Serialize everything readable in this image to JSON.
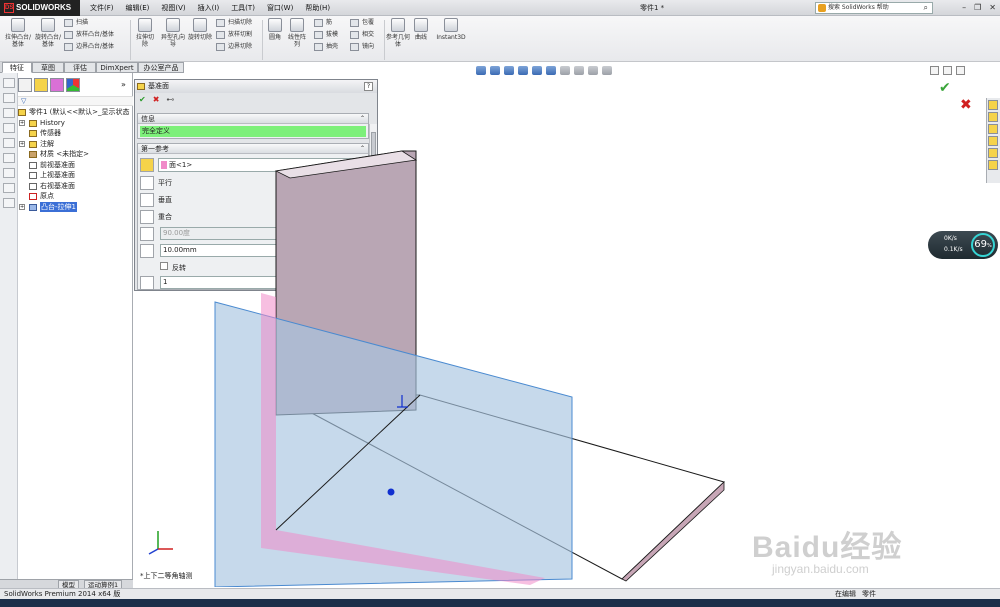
{
  "app": {
    "brand": "SOLIDWORKS",
    "doc_title": "零件1 *"
  },
  "menu": [
    "文件(F)",
    "编辑(E)",
    "视图(V)",
    "插入(I)",
    "工具(T)",
    "窗口(W)",
    "帮助(H)"
  ],
  "search": {
    "placeholder": "搜索 SolidWorks 帮助"
  },
  "ribbon": {
    "big": [
      "拉伸凸台/基体",
      "旋转凸台/基体",
      "拉伸切除",
      "异型孔向导",
      "旋转切除",
      "圆角",
      "线性阵列",
      "参考几何体",
      "曲线",
      "Instant3D"
    ],
    "small": [
      "扫描",
      "放样凸台/基体",
      "边界凸台/基体",
      "扫描切除",
      "放样切割",
      "边界切除",
      "筋",
      "拔模",
      "抽壳",
      "包覆",
      "相交",
      "镜向"
    ]
  },
  "tabs": [
    "特征",
    "草图",
    "评估",
    "DimXpert",
    "办公室产品"
  ],
  "tree": {
    "root": "零件1 (默认<<默认>_显示状态",
    "items": [
      "History",
      "传感器",
      "注解",
      "材质 <未指定>",
      "前视基准面",
      "上视基准面",
      "右视基准面",
      "原点",
      "凸台-拉伸1"
    ]
  },
  "bottom_tabs": [
    "模型",
    "运动算例1"
  ],
  "pm": {
    "title": "基准面",
    "help": "?",
    "info_group": "信息",
    "info_msg": "完全定义",
    "ref_group": "第一参考",
    "ref_value": "面<1>",
    "opts": [
      "平行",
      "垂直",
      "重合"
    ],
    "angle": "90.00度",
    "distance": "10.00mm",
    "flip": "反转",
    "count": "1"
  },
  "view": {
    "orientation": "*上下二等角轴测"
  },
  "net": {
    "up": "0K/s",
    "down": "0.1K/s",
    "pct": "69"
  },
  "watermark": {
    "logo": "Baidu经验",
    "url": "jingyan.baidu.com"
  },
  "status": {
    "left": "SolidWorks Premium 2014 x64 版",
    "mode": "在编辑",
    "part": "零件"
  },
  "colors": {
    "plane": "#a8c4e0",
    "message": "#7df07a",
    "highlight": "#f08ac8",
    "selection": "#3b6fd6"
  }
}
